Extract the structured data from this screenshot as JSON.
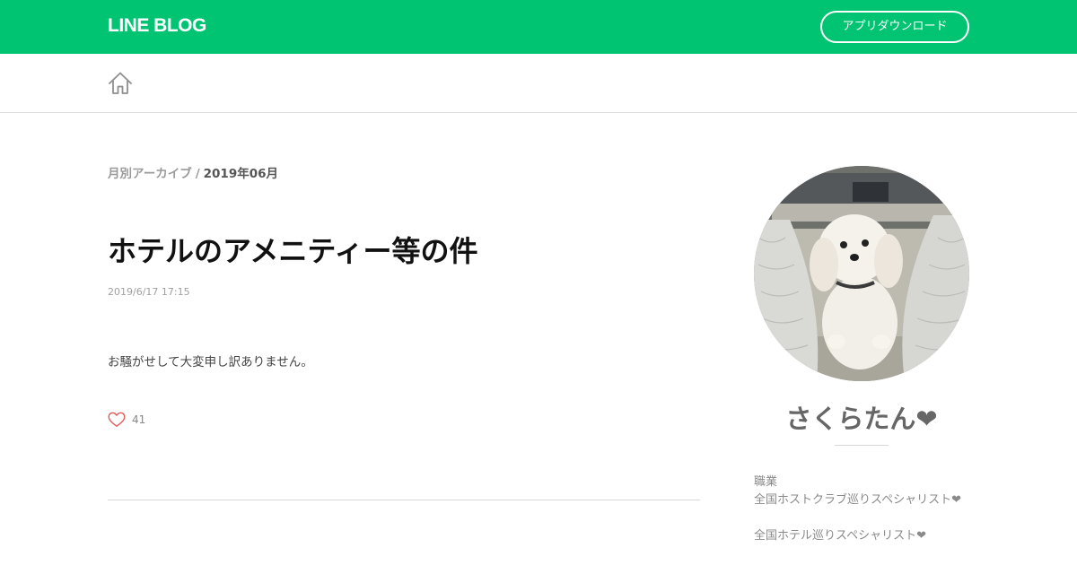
{
  "header": {
    "logo_text": "LINE BLOG",
    "app_download_label": "アプリダウンロード",
    "brand_color": "#00c472"
  },
  "subnav": {
    "home_icon": "home-icon"
  },
  "breadcrumb": {
    "archive_label": "月別アーカイブ",
    "separator": "/",
    "current": "2019年06月"
  },
  "post": {
    "title": "ホテルのアメニティー等の件",
    "date": "2019/6/17 17:15",
    "body": "お騒がせして大変申し訳ありません。",
    "like_icon": "heart-outline-icon",
    "like_count": "41"
  },
  "profile": {
    "avatar_alt": "dog-photo",
    "name": "さくらたん❤",
    "desc_lines": [
      "職業",
      "全国ホストクラブ巡りスペシャリスト❤",
      "",
      "全国ホテル巡りスペシャリスト❤"
    ]
  }
}
